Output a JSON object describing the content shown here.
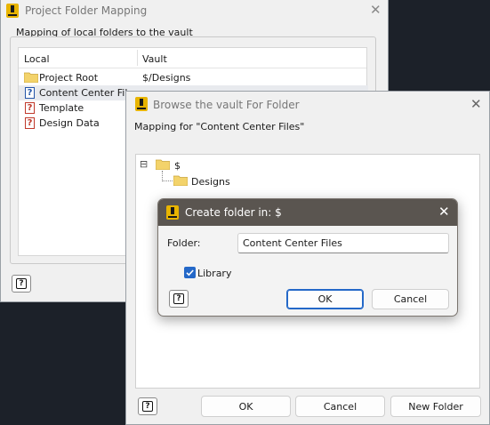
{
  "mapping_window": {
    "title": "Project Folder Mapping",
    "group_label": "Mapping of local folders to the vault",
    "columns": [
      "Local",
      "Vault"
    ],
    "rows": [
      {
        "local": "Project Root",
        "vault": "$/Designs",
        "icon": "folder-icon"
      },
      {
        "local": "Content Center Files",
        "vault": "",
        "icon": "question-icon"
      },
      {
        "local": "Template",
        "vault": "",
        "icon": "red-question-icon"
      },
      {
        "local": "Design Data",
        "vault": "",
        "icon": "red-question-icon"
      }
    ]
  },
  "browse_window": {
    "title": "Browse the vault For Folder",
    "mapping_for": "Mapping for \"Content Center Files\"",
    "tree": {
      "root": "$",
      "child": "Designs"
    },
    "expander": "⊟",
    "buttons": {
      "ok": "OK",
      "cancel": "Cancel",
      "new_folder": "New Folder"
    }
  },
  "create_dialog": {
    "title": "Create folder in: $",
    "folder_label": "Folder:",
    "folder_value": "Content Center Files",
    "library_label": "Library",
    "library_checked": true,
    "buttons": {
      "ok": "OK",
      "cancel": "Cancel"
    }
  },
  "close_glyph": "✕",
  "help_glyph": "?",
  "colors": {
    "desktop": "#1c2129",
    "dialog_title_bg": "#5a5550",
    "accent": "#2468c8",
    "folder_yellow": "#f3d36b",
    "error_red": "#c0392b"
  }
}
